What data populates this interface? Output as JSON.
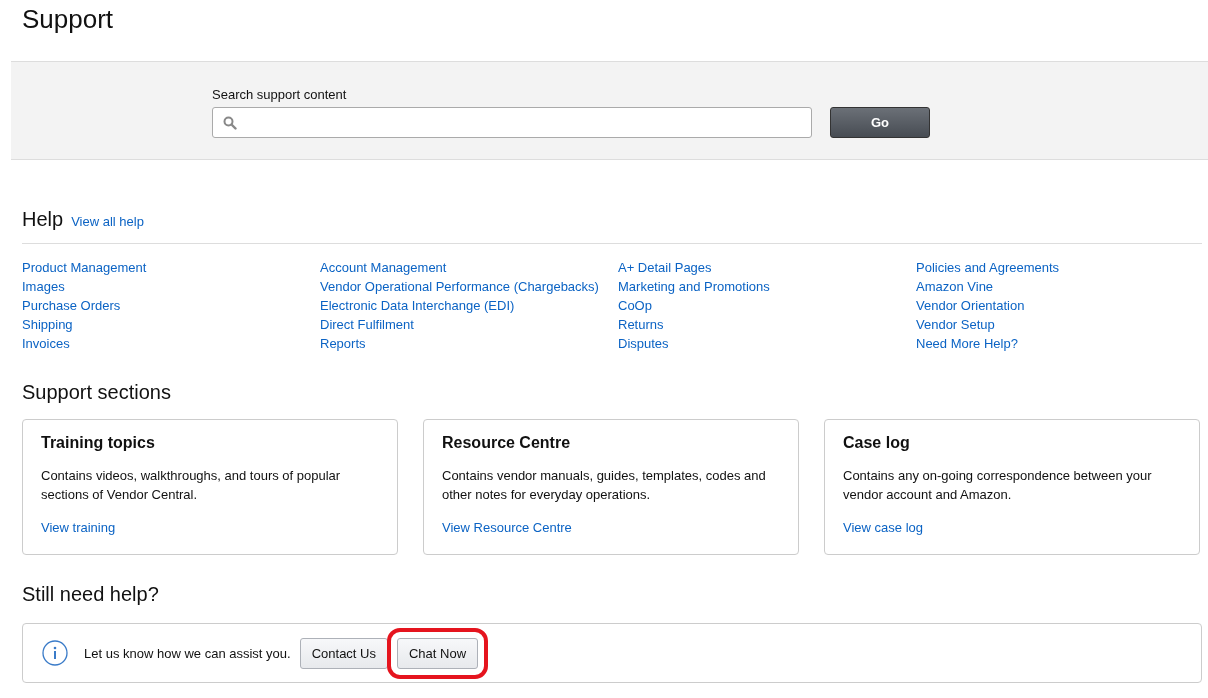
{
  "page_title": "Support",
  "search": {
    "label": "Search support content",
    "button": "Go"
  },
  "help": {
    "heading": "Help",
    "view_all": "View all help",
    "columns": [
      {
        "links": [
          "Product Management",
          "Images",
          "Purchase Orders",
          "Shipping",
          "Invoices"
        ]
      },
      {
        "links": [
          "Account Management",
          "Vendor Operational Performance (Chargebacks)",
          "Electronic Data Interchange (EDI)",
          "Direct Fulfilment",
          "Reports"
        ]
      },
      {
        "links": [
          "A+ Detail Pages",
          "Marketing and Promotions",
          "CoOp",
          "Returns",
          "Disputes"
        ]
      },
      {
        "links": [
          "Policies and Agreements",
          "Amazon Vine",
          "Vendor Orientation",
          "Vendor Setup",
          "Need More Help?"
        ]
      }
    ]
  },
  "support_sections": {
    "heading": "Support sections",
    "cards": [
      {
        "title": "Training topics",
        "description": "Contains videos, walkthroughs, and tours of popular sections of Vendor Central.",
        "link": "View training"
      },
      {
        "title": "Resource Centre",
        "description": "Contains vendor manuals, guides, templates, codes and other notes for everyday operations.",
        "link": "View Resource Centre"
      },
      {
        "title": "Case log",
        "description": "Contains any on-going correspondence between your vendor account and Amazon.",
        "link": "View case log"
      }
    ]
  },
  "still_need_help": {
    "heading": "Still need help?",
    "message": "Let us know how we can assist you.",
    "buttons": [
      {
        "label": "Contact Us",
        "highlighted": false
      },
      {
        "label": "Chat Now",
        "highlighted": true
      }
    ]
  }
}
